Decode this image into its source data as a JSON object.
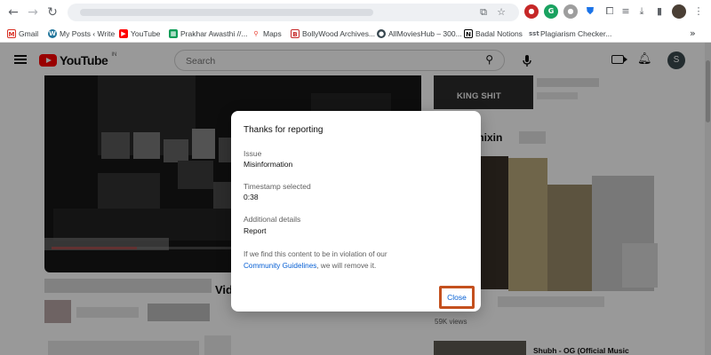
{
  "bookmarks": [
    {
      "label": "Gmail",
      "icon": "gmail-icon"
    },
    {
      "label": "My Posts ‹ Write",
      "icon": "wordpress-icon"
    },
    {
      "label": "YouTube",
      "icon": "youtube-icon"
    },
    {
      "label": "Prakhar Awasthi //...",
      "icon": "sheets-icon"
    },
    {
      "label": "Maps",
      "icon": "maps-pin-icon"
    },
    {
      "label": "BollyWood Archives...",
      "icon": "page-icon"
    },
    {
      "label": "AllMoviesHub – 300...",
      "icon": "globe-icon"
    },
    {
      "label": "Badal Notions",
      "icon": "notion-icon"
    },
    {
      "label": "Plagiarism Checker...",
      "icon": "checker-icon"
    }
  ],
  "youtube": {
    "logo_text": "YouTube",
    "region": "IN",
    "search_placeholder": "Search",
    "profile_initial": "S",
    "video_title_fragment": "Vid",
    "right_thumb_caption": "KING SHIT",
    "mix_heading_fragment": "mixin",
    "mix_views": "59K views",
    "next_video_title": "Shubh - OG (Official Music"
  },
  "dialog": {
    "title": "Thanks for reporting",
    "issue_label": "Issue",
    "issue_value": "Misinformation",
    "timestamp_label": "Timestamp selected",
    "timestamp_value": "0:38",
    "details_label": "Additional details",
    "details_value": "Report",
    "note_before": "If we find this content to be in violation of our",
    "note_link": "Community Guidelines",
    "note_after": ", we will remove it.",
    "close_label": "Close"
  }
}
